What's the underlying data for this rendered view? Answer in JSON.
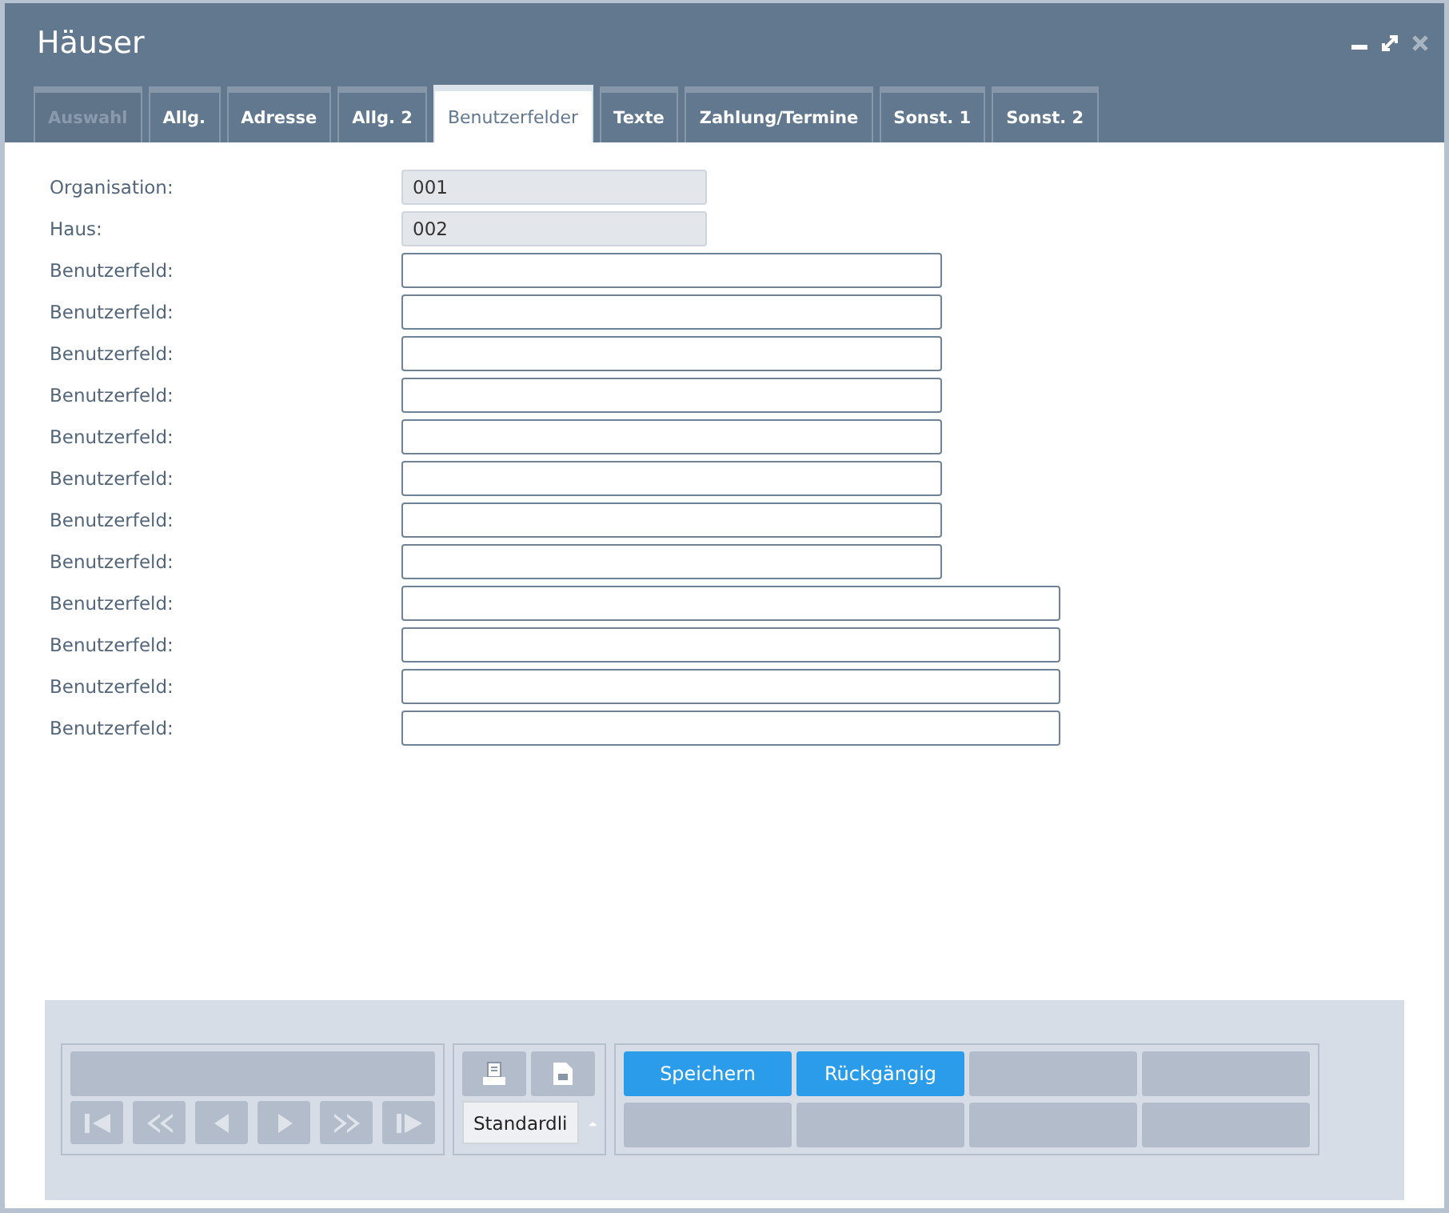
{
  "window": {
    "title": "Häuser"
  },
  "tabs": [
    {
      "label": "Auswahl",
      "selected": false,
      "disabled": true
    },
    {
      "label": "Allg.",
      "selected": false,
      "disabled": false
    },
    {
      "label": "Adresse",
      "selected": false,
      "disabled": false
    },
    {
      "label": "Allg. 2",
      "selected": false,
      "disabled": false
    },
    {
      "label": "Benutzerfelder",
      "selected": true,
      "disabled": false
    },
    {
      "label": "Texte",
      "selected": false,
      "disabled": false
    },
    {
      "label": "Zahlung/Termine",
      "selected": false,
      "disabled": false
    },
    {
      "label": "Sonst. 1",
      "selected": false,
      "disabled": false
    },
    {
      "label": "Sonst. 2",
      "selected": false,
      "disabled": false
    }
  ],
  "fields": [
    {
      "label": "Organisation:",
      "kind": "readonly",
      "value": "001"
    },
    {
      "label": "Haus:",
      "kind": "readonly",
      "value": "002"
    },
    {
      "label": "Benutzerfeld:",
      "kind": "short"
    },
    {
      "label": "Benutzerfeld:",
      "kind": "short"
    },
    {
      "label": "Benutzerfeld:",
      "kind": "short"
    },
    {
      "label": "Benutzerfeld:",
      "kind": "short"
    },
    {
      "label": "Benutzerfeld:",
      "kind": "short"
    },
    {
      "label": "Benutzerfeld:",
      "kind": "short"
    },
    {
      "label": "Benutzerfeld:",
      "kind": "short"
    },
    {
      "label": "Benutzerfeld:",
      "kind": "short"
    },
    {
      "label": "Benutzerfeld:",
      "kind": "long"
    },
    {
      "label": "Benutzerfeld:",
      "kind": "long"
    },
    {
      "label": "Benutzerfeld:",
      "kind": "long"
    },
    {
      "label": "Benutzerfeld:",
      "kind": "long"
    }
  ],
  "print": {
    "layout": "Standardli"
  },
  "actions": [
    "Speichern",
    "Rückgängig"
  ]
}
